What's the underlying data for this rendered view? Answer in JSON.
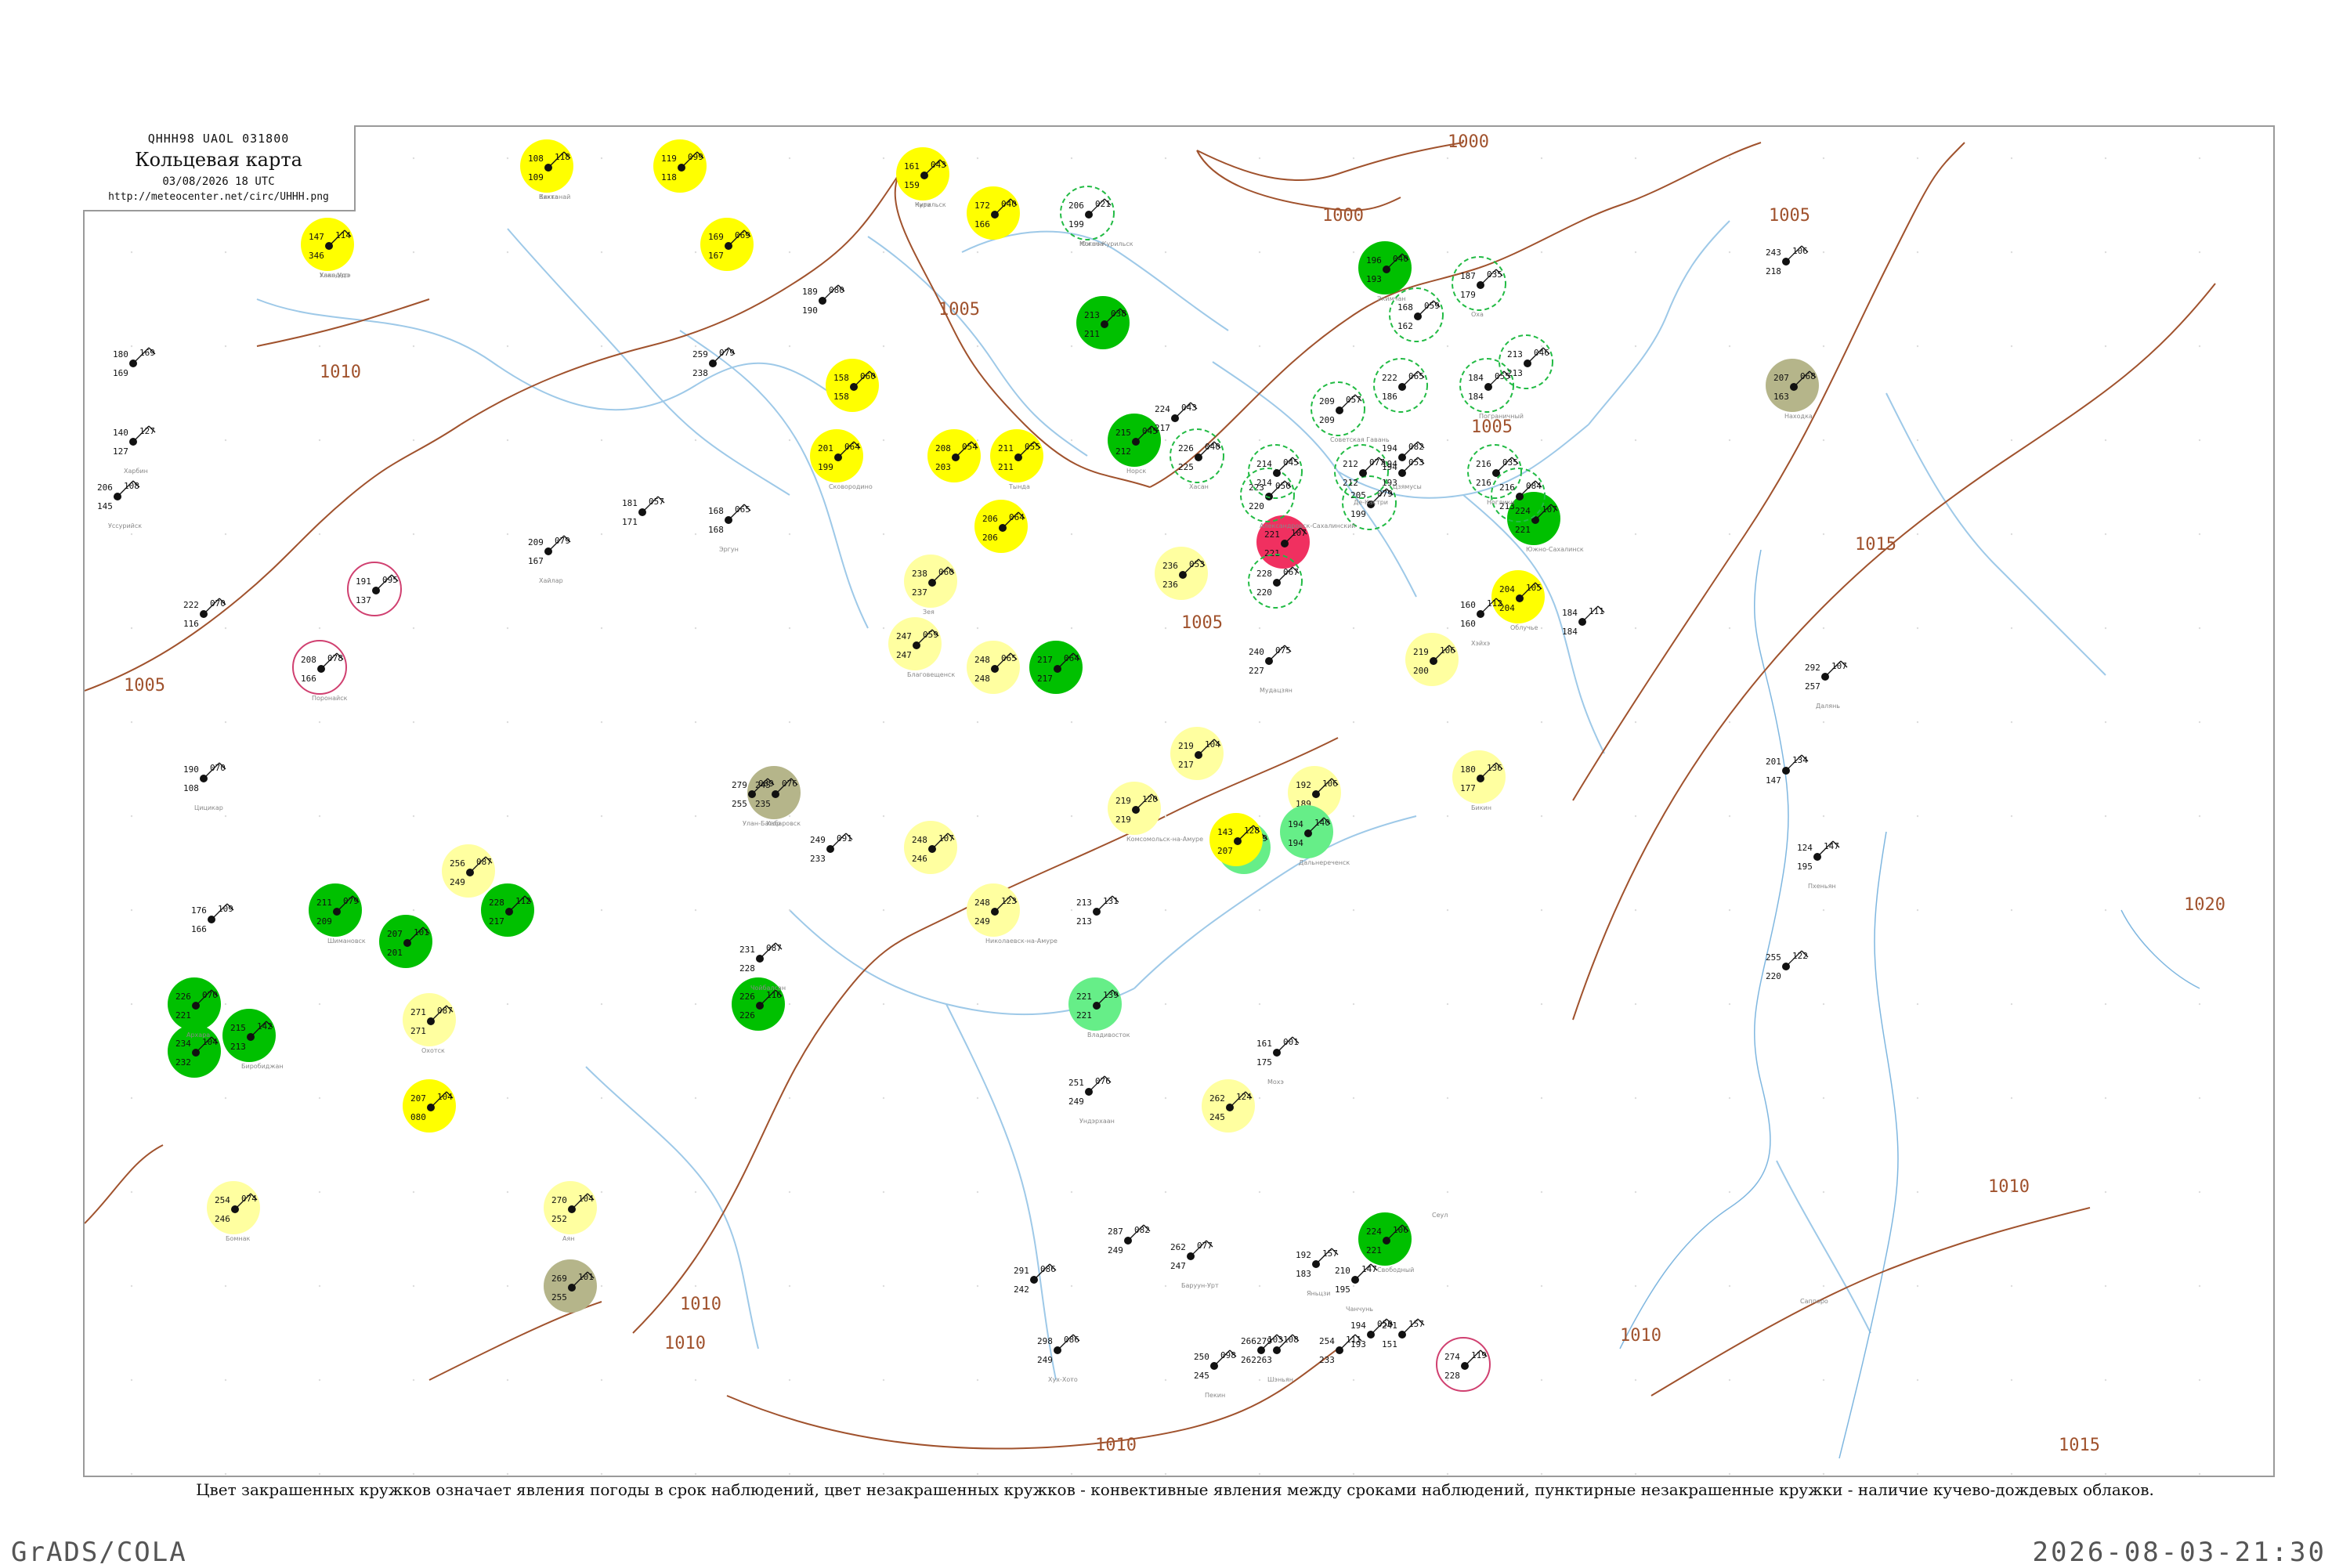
{
  "header": {
    "code": "QHHH98  UAOL  031800",
    "title": "Кольцевая карта",
    "date": "03/08/2026 18 UTC",
    "url": "http://meteocenter.net/circ/UHHH.png"
  },
  "legend": "Цвет закрашенных кружков означает явления погоды в срок наблюдений, цвет незакрашенных кружков - конвективные явления между сроками наблюдений, пунктирные незакрашенные кружки - наличие кучево-дождевых облаков.",
  "footer": {
    "left": "GrADS/COLA",
    "right": "2026-08-03-21:30"
  },
  "colors": {
    "isobar": "#a0522d",
    "river": "#9ec9e8",
    "yellow": "#ffff00",
    "light_yellow": "#ffffa0",
    "green": "#00c000",
    "light_green": "#66ee88",
    "olive": "#b5b58a",
    "red": "#f03060",
    "dashed_green": "#22bb44",
    "pink": "#d04070"
  },
  "isobars": [
    {
      "label": "1000"
    },
    {
      "label": "1000"
    },
    {
      "label": "1005"
    },
    {
      "label": "1005"
    },
    {
      "label": "1005"
    },
    {
      "label": "1005"
    },
    {
      "label": "1005"
    },
    {
      "label": "1010"
    },
    {
      "label": "1010"
    },
    {
      "label": "1010"
    },
    {
      "label": "1010"
    },
    {
      "label": "1010"
    },
    {
      "label": "1010"
    },
    {
      "label": "1015"
    },
    {
      "label": "1015"
    },
    {
      "label": "1020"
    }
  ],
  "stations": [
    {
      "t": "108",
      "w": "118",
      "p": "109",
      "kind": "yellow"
    },
    {
      "t": "119",
      "w": "099",
      "p": "118",
      "kind": "yellow"
    },
    {
      "t": "147",
      "w": "114",
      "p": "346",
      "kind": "yellow"
    },
    {
      "t": "169",
      "w": "069",
      "p": "167",
      "kind": "yellow"
    },
    {
      "t": "161",
      "w": "043",
      "p": "159",
      "kind": "yellow"
    },
    {
      "t": "172",
      "w": "040",
      "p": "166",
      "kind": "yellow"
    },
    {
      "t": "206",
      "w": "021",
      "p": "199",
      "kind": "dashed"
    },
    {
      "t": "158",
      "w": "060",
      "p": "158",
      "kind": "yellow"
    },
    {
      "t": "201",
      "w": "064",
      "p": "199",
      "kind": "yellow"
    },
    {
      "t": "208",
      "w": "054",
      "p": "203",
      "kind": "yellow"
    },
    {
      "t": "211",
      "w": "055",
      "p": "211",
      "kind": "yellow"
    },
    {
      "t": "206",
      "w": "064",
      "p": "206",
      "kind": "yellow"
    },
    {
      "t": "238",
      "w": "060",
      "p": "237",
      "kind": "light_yellow"
    },
    {
      "t": "236",
      "w": "053",
      "p": "236",
      "kind": "light_yellow"
    },
    {
      "t": "247",
      "w": "059",
      "p": "247",
      "kind": "light_yellow"
    },
    {
      "t": "248",
      "w": "065",
      "p": "248",
      "kind": "light_yellow"
    },
    {
      "t": "245",
      "w": "076",
      "p": "235",
      "kind": "olive"
    },
    {
      "t": "219",
      "w": "104",
      "p": "217",
      "kind": "light_yellow"
    },
    {
      "t": "219",
      "w": "120",
      "p": "219",
      "kind": "light_yellow"
    },
    {
      "t": "248",
      "w": "107",
      "p": "246",
      "kind": "light_yellow"
    },
    {
      "t": "248",
      "w": "123",
      "p": "249",
      "kind": "light_yellow"
    },
    {
      "t": "256",
      "w": "087",
      "p": "249",
      "kind": "light_yellow"
    },
    {
      "t": "271",
      "w": "087",
      "p": "271",
      "kind": "light_yellow"
    },
    {
      "t": "207",
      "w": "104",
      "p": "080",
      "kind": "yellow"
    },
    {
      "t": "270",
      "w": "104",
      "p": "252",
      "kind": "light_yellow"
    },
    {
      "t": "269",
      "w": "101",
      "p": "255",
      "kind": "olive"
    },
    {
      "t": "254",
      "w": "074",
      "p": "246",
      "kind": "light_yellow"
    },
    {
      "t": "262",
      "w": "124",
      "p": "245",
      "kind": "light_yellow"
    },
    {
      "t": "196",
      "w": "040",
      "p": "193",
      "kind": "green"
    },
    {
      "t": "213",
      "w": "038",
      "p": "211",
      "kind": "green"
    },
    {
      "t": "215",
      "w": "045",
      "p": "212",
      "kind": "green"
    },
    {
      "t": "217",
      "w": "064",
      "p": "217",
      "kind": "green"
    },
    {
      "t": "211",
      "w": "079",
      "p": "209",
      "kind": "green"
    },
    {
      "t": "228",
      "w": "112",
      "p": "217",
      "kind": "green"
    },
    {
      "t": "224",
      "w": "106",
      "p": "221",
      "kind": "green"
    },
    {
      "t": "207",
      "w": "101",
      "p": "201",
      "kind": "green"
    },
    {
      "t": "226",
      "w": "070",
      "p": "221",
      "kind": "green"
    },
    {
      "t": "234",
      "w": "104",
      "p": "232",
      "kind": "green"
    },
    {
      "t": "215",
      "w": "142",
      "p": "213",
      "kind": "green"
    },
    {
      "t": "226",
      "w": "116",
      "p": "226",
      "kind": "green"
    },
    {
      "t": "204",
      "w": "105",
      "p": "204",
      "kind": "yellow"
    },
    {
      "t": "219",
      "w": "106",
      "p": "200",
      "kind": "light_yellow"
    },
    {
      "t": "180",
      "w": "136",
      "p": "177",
      "kind": "light_yellow"
    },
    {
      "t": "192",
      "w": "106",
      "p": "189",
      "kind": "light_yellow"
    },
    {
      "t": "194",
      "w": "140",
      "p": "194",
      "kind": "light_green"
    },
    {
      "t": "217",
      "w": "139",
      "p": "217",
      "kind": "light_green"
    },
    {
      "t": "221",
      "w": "139",
      "p": "221",
      "kind": "light_green"
    },
    {
      "t": "143",
      "w": "128",
      "p": "207",
      "kind": "yellow"
    },
    {
      "t": "207",
      "w": "068",
      "p": "163",
      "kind": "olive"
    },
    {
      "t": "221",
      "w": "107",
      "p": "221",
      "kind": "red"
    },
    {
      "t": "224",
      "w": "107",
      "p": "221",
      "kind": "green"
    },
    {
      "t": "191",
      "w": "095",
      "p": "137",
      "kind": "pink"
    },
    {
      "t": "208",
      "w": "078",
      "p": "166",
      "kind": "pink"
    },
    {
      "t": "274",
      "w": "119",
      "p": "228",
      "kind": "pink"
    },
    {
      "t": "187",
      "w": "035",
      "p": "179",
      "kind": "dashed"
    },
    {
      "t": "168",
      "w": "059",
      "p": "162",
      "kind": "dashed"
    },
    {
      "t": "216",
      "w": "035",
      "p": "216",
      "kind": "dashed"
    },
    {
      "t": "216",
      "w": "084",
      "p": "213",
      "kind": "dashed"
    },
    {
      "t": "223",
      "w": "050",
      "p": "220",
      "kind": "dashed"
    },
    {
      "t": "228",
      "w": "067",
      "p": "220",
      "kind": "dashed"
    },
    {
      "t": "209",
      "w": "057",
      "p": "209",
      "kind": "dashed"
    },
    {
      "t": "205",
      "w": "079",
      "p": "199",
      "kind": "dashed"
    },
    {
      "t": "212",
      "w": "077",
      "p": "212",
      "kind": "dashed"
    },
    {
      "t": "214",
      "w": "045",
      "p": "214",
      "kind": "dashed"
    },
    {
      "t": "226",
      "w": "040",
      "p": "225",
      "kind": "dashed"
    },
    {
      "t": "222",
      "w": "065",
      "p": "186",
      "kind": "dashed"
    },
    {
      "t": "184",
      "w": "055",
      "p": "184",
      "kind": "dashed"
    },
    {
      "t": "213",
      "w": "046",
      "p": "213",
      "kind": "dashed"
    },
    {
      "t": "206",
      "w": "108",
      "p": "145",
      "kind": "plain"
    },
    {
      "t": "180",
      "w": "169",
      "p": "169",
      "kind": "plain"
    },
    {
      "t": "140",
      "w": "127",
      "p": "127",
      "kind": "plain"
    },
    {
      "t": "222",
      "w": "070",
      "p": "116",
      "kind": "plain"
    },
    {
      "t": "190",
      "w": "070",
      "p": "108",
      "kind": "plain"
    },
    {
      "t": "176",
      "w": "109",
      "p": "166",
      "kind": "plain"
    },
    {
      "t": "240",
      "w": "075",
      "p": "227",
      "kind": "plain"
    },
    {
      "t": "224",
      "w": "043",
      "p": "217",
      "kind": "plain"
    },
    {
      "t": "194",
      "w": "082",
      "p": "194",
      "kind": "plain"
    },
    {
      "t": "194",
      "w": "053",
      "p": "193",
      "kind": "plain"
    },
    {
      "t": "160",
      "w": "112",
      "p": "160",
      "kind": "plain"
    },
    {
      "t": "184",
      "w": "111",
      "p": "184",
      "kind": "plain"
    },
    {
      "t": "161",
      "w": "001",
      "p": "175",
      "kind": "plain"
    },
    {
      "t": "189",
      "w": "080",
      "p": "190",
      "kind": "plain"
    },
    {
      "t": "209",
      "w": "079",
      "p": "167",
      "kind": "plain"
    },
    {
      "t": "181",
      "w": "057",
      "p": "171",
      "kind": "plain"
    },
    {
      "t": "168",
      "w": "065",
      "p": "168",
      "kind": "plain"
    },
    {
      "t": "259",
      "w": "079",
      "p": "238",
      "kind": "plain"
    },
    {
      "t": "279",
      "w": "089",
      "p": "255",
      "kind": "plain"
    },
    {
      "t": "249",
      "w": "091",
      "p": "233",
      "kind": "plain"
    },
    {
      "t": "231",
      "w": "087",
      "p": "228",
      "kind": "plain"
    },
    {
      "t": "213",
      "w": "131",
      "p": "213",
      "kind": "plain"
    },
    {
      "t": "251",
      "w": "076",
      "p": "249",
      "kind": "plain"
    },
    {
      "t": "287",
      "w": "082",
      "p": "249",
      "kind": "plain"
    },
    {
      "t": "262",
      "w": "077",
      "p": "247",
      "kind": "plain"
    },
    {
      "t": "291",
      "w": "086",
      "p": "242",
      "kind": "plain"
    },
    {
      "t": "298",
      "w": "086",
      "p": "249",
      "kind": "plain"
    },
    {
      "t": "266",
      "w": "103",
      "p": "262",
      "kind": "plain"
    },
    {
      "t": "250",
      "w": "098",
      "p": "245",
      "kind": "plain"
    },
    {
      "t": "254",
      "w": "111",
      "p": "233",
      "kind": "plain"
    },
    {
      "t": "279",
      "w": "108",
      "p": "263",
      "kind": "plain"
    },
    {
      "t": "241",
      "w": "157",
      "p": "151",
      "kind": "plain"
    },
    {
      "t": "210",
      "w": "147",
      "p": "195",
      "kind": "plain"
    },
    {
      "t": "194",
      "w": "050",
      "p": "193",
      "kind": "plain"
    },
    {
      "t": "192",
      "w": "157",
      "p": "183",
      "kind": "plain"
    },
    {
      "t": "201",
      "w": "134",
      "p": "147",
      "kind": "plain"
    },
    {
      "t": "292",
      "w": "107",
      "p": "257",
      "kind": "plain"
    },
    {
      "t": "243",
      "w": "106",
      "p": "218",
      "kind": "plain"
    },
    {
      "t": "124",
      "w": "147",
      "p": "195",
      "kind": "plain"
    },
    {
      "t": "255",
      "w": "122",
      "p": "220",
      "kind": "plain"
    }
  ],
  "station_names": [
    "Кяхта",
    "Улан-Удэ",
    "Чита",
    "Могоча",
    "Сковородино",
    "Тында",
    "Зея",
    "Благовещенск",
    "Хабаровск",
    "Комсомольск-на-Амуре",
    "Николаевск-на-Амуре",
    "Охотск",
    "Аян",
    "Бомнак",
    "Экимчан",
    "Норск",
    "Шимановск",
    "Свободный",
    "Архара",
    "Биробиджан",
    "Облучье",
    "Бикин",
    "Дальнереченск",
    "Владивосток",
    "Находка",
    "Южно-Сахалинск",
    "Поронайск",
    "Оха",
    "Ноглики",
    "Александровск-Сахалинский",
    "Советская Гавань",
    "Де-Кастри",
    "Хасан",
    "Пограничный",
    "Уссурийск",
    "Харбин",
    "Цицикар",
    "Мудацзян",
    "Цзямусы",
    "Хэйхэ",
    "Мохэ",
    "Хайлар",
    "Эргун",
    "Улан-Батор",
    "Чойбалсан",
    "Ундэрхаан",
    "Баруун-Урт",
    "Хух-Хото",
    "Пекин",
    "Шэньян",
    "Чанчунь",
    "Яньцзи",
    "Далянь",
    "Пхеньян",
    "Сеул",
    "Саппоро",
    "Вакканай",
    "Хакодатэ",
    "Курильск",
    "Южно-Курильск"
  ]
}
